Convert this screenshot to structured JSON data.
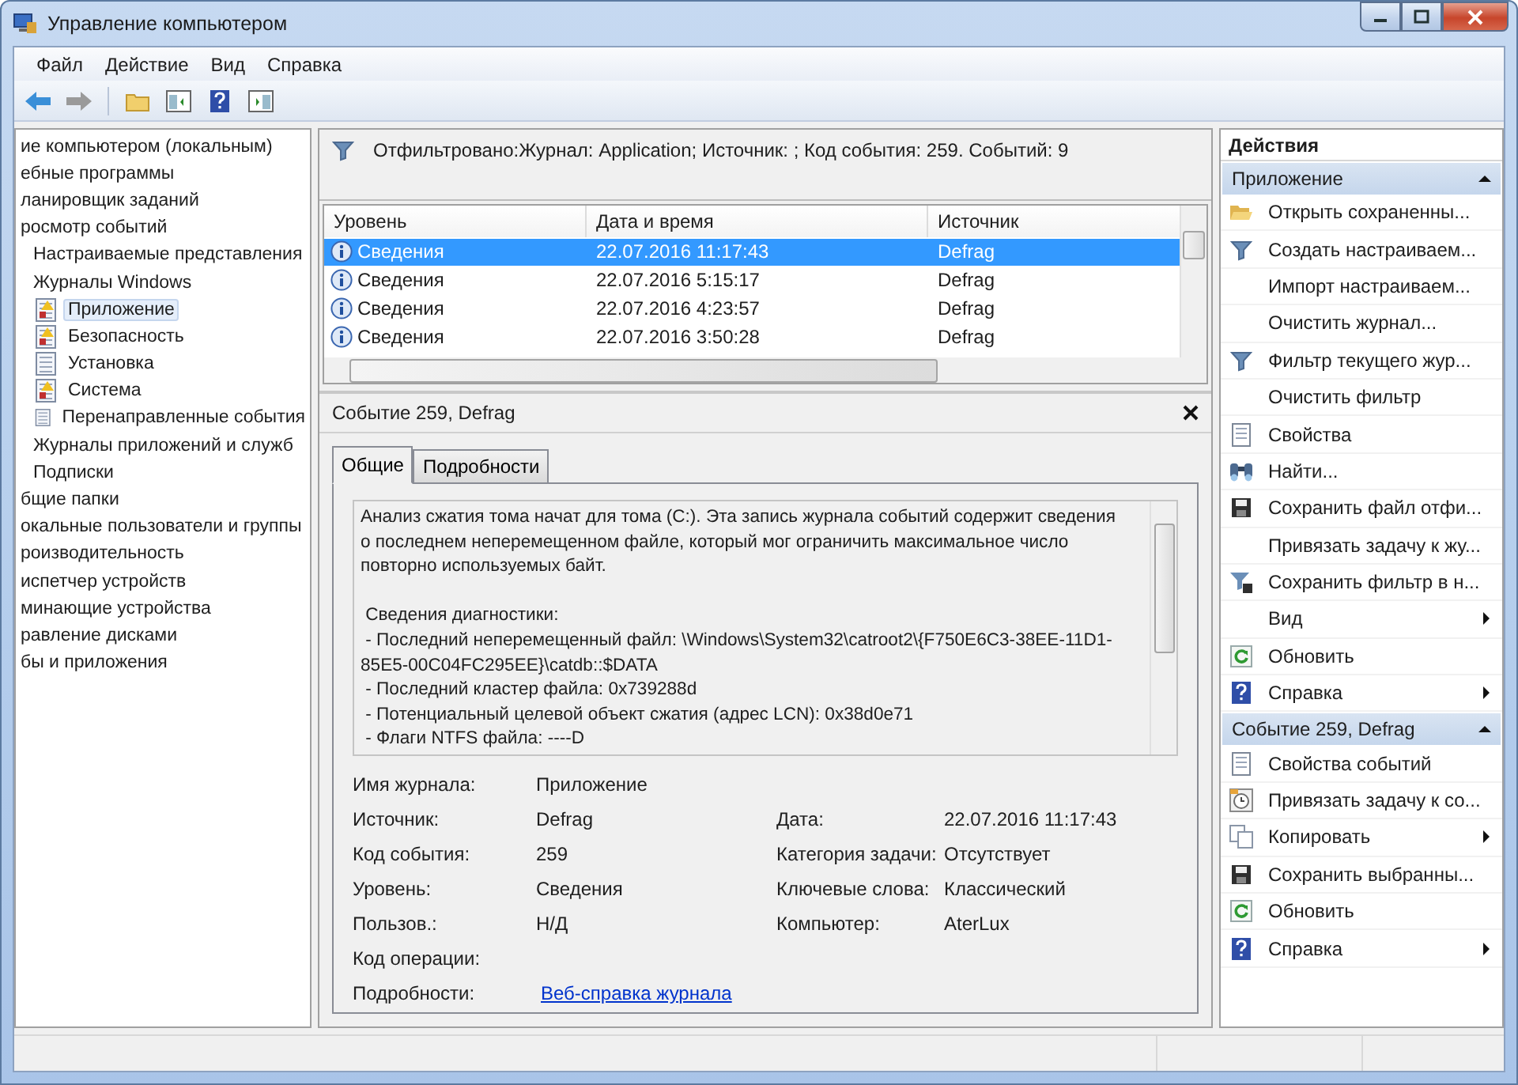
{
  "window": {
    "title": "Управление компьютером"
  },
  "menu": [
    "Файл",
    "Действие",
    "Вид",
    "Справка"
  ],
  "tree": [
    {
      "label": "ие компьютером (локальным)",
      "selected": false,
      "children": [
        {
          "label": "ебные программы",
          "selected": false,
          "children": [
            {
              "label": "ланировщик заданий",
              "selected": false
            },
            {
              "label": "росмотр событий",
              "selected": false,
              "children": [
                {
                  "label": "Настраиваемые представления",
                  "selected": false
                },
                {
                  "label": "Журналы Windows",
                  "selected": false,
                  "children": [
                    {
                      "label": "Приложение",
                      "selected": true
                    },
                    {
                      "label": "Безопасность",
                      "selected": false
                    },
                    {
                      "label": "Установка",
                      "selected": false
                    },
                    {
                      "label": "Система",
                      "selected": false
                    },
                    {
                      "label": "Перенаправленные события",
                      "selected": false
                    }
                  ]
                },
                {
                  "label": "Журналы приложений и служб",
                  "selected": false
                },
                {
                  "label": "Подписки",
                  "selected": false
                }
              ]
            },
            {
              "label": "бщие папки",
              "selected": false
            },
            {
              "label": "окальные пользователи и группы",
              "selected": false
            },
            {
              "label": "роизводительность",
              "selected": false
            },
            {
              "label": "испетчер устройств",
              "selected": false
            }
          ]
        },
        {
          "label": "минающие устройства",
          "selected": false,
          "children": [
            {
              "label": "равление дисками",
              "selected": false
            }
          ]
        },
        {
          "label": "бы и приложения",
          "selected": false
        }
      ]
    }
  ],
  "filter_bar": {
    "text": "Отфильтровано:Журнал: Application; Источник: ; Код события: 259. Событий: 9"
  },
  "events": {
    "columns": [
      "Уровень",
      "Дата и время",
      "Источник"
    ],
    "rows": [
      {
        "level": "Сведения",
        "datetime": "22.07.2016 11:17:43",
        "source": "Defrag",
        "selected": true
      },
      {
        "level": "Сведения",
        "datetime": "22.07.2016 5:15:17",
        "source": "Defrag",
        "selected": false
      },
      {
        "level": "Сведения",
        "datetime": "22.07.2016 4:23:57",
        "source": "Defrag",
        "selected": false
      },
      {
        "level": "Сведения",
        "datetime": "22.07.2016 3:50:28",
        "source": "Defrag",
        "selected": false
      }
    ]
  },
  "event_details": {
    "title": "Событие 259, Defrag",
    "tabs": [
      {
        "label": "Общие",
        "selected": true
      },
      {
        "label": "Подробности",
        "selected": false
      }
    ],
    "message": "Анализ сжатия тома начат для тома (C:). Эта запись журнала событий содержит сведения\nо последнем неперемещенном файле, который мог ограничить максимальное число\nповторно используемых байт.\n\n Сведения диагностики:\n - Последний неперемещенный файл: \\Windows\\System32\\catroot2\\{F750E6C3-38EE-11D1-\n85E5-00C04FC295EE}\\catdb::$DATA\n - Последний кластер файла: 0x739288d\n - Потенциальный целевой объект сжатия (адрес LCN): 0x38d0e71\n - Флаги NTFS файла: ----D",
    "rows": [
      [
        {
          "label": "Имя журнала:",
          "value": "Приложение",
          "kind": "text"
        }
      ],
      [
        {
          "label": "Источник:",
          "value": "Defrag",
          "kind": "text"
        },
        {
          "label": "Дата:",
          "value": "22.07.2016 11:17:43",
          "kind": "text"
        }
      ],
      [
        {
          "label": "Код события:",
          "value": "259",
          "kind": "text"
        },
        {
          "label": "Категория задачи:",
          "value": "Отсутствует",
          "kind": "text"
        }
      ],
      [
        {
          "label": "Уровень:",
          "value": "Сведения",
          "kind": "text"
        },
        {
          "label": "Ключевые слова:",
          "value": "Классический",
          "kind": "text"
        }
      ],
      [
        {
          "label": "Пользов.:",
          "value": "Н/Д",
          "kind": "text"
        },
        {
          "label": "Компьютер:",
          "value": "AterLux",
          "kind": "text"
        }
      ],
      [
        {
          "label": "Код операции:"
        }
      ],
      [
        {
          "label": "Подробности:",
          "value": "Веб-справка журнала",
          "kind": "link"
        }
      ]
    ]
  },
  "actions": {
    "title": "Действия",
    "sections": [
      {
        "title": "Приложение",
        "expanded": true,
        "items": [
          {
            "label": "Открыть сохраненны...",
            "submenu": false
          },
          {
            "label": "Создать настраиваем...",
            "submenu": false
          },
          {
            "label": "Импорт настраиваем...",
            "submenu": false
          },
          {
            "label": "Очистить журнал...",
            "submenu": false
          },
          {
            "label": "Фильтр текущего жур...",
            "submenu": false
          },
          {
            "label": "Очистить фильтр",
            "submenu": false
          },
          {
            "label": "Свойства",
            "submenu": false
          },
          {
            "label": "Найти...",
            "submenu": false
          },
          {
            "label": "Сохранить файл отфи...",
            "submenu": false
          },
          {
            "label": "Привязать задачу к жу...",
            "submenu": false
          },
          {
            "label": "Сохранить фильтр в н...",
            "submenu": false
          },
          {
            "label": "Вид",
            "submenu": true
          },
          {
            "label": "Обновить",
            "submenu": false
          },
          {
            "label": "Справка",
            "submenu": true
          }
        ]
      },
      {
        "title": "Событие 259, Defrag",
        "expanded": true,
        "items": [
          {
            "label": "Свойства событий",
            "submenu": false
          },
          {
            "label": "Привязать задачу к со...",
            "submenu": false
          },
          {
            "label": "Копировать",
            "submenu": true
          },
          {
            "label": "Сохранить выбранны...",
            "submenu": false
          },
          {
            "label": "Обновить",
            "submenu": false
          },
          {
            "label": "Справка",
            "submenu": true
          }
        ]
      }
    ]
  }
}
